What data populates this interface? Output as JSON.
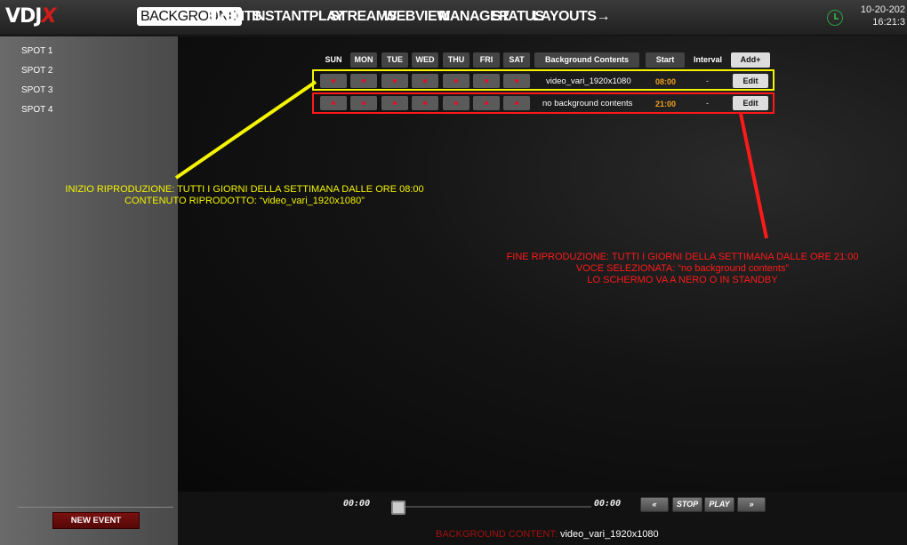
{
  "app": {
    "logo_text": "VDJ",
    "logo_accent": "X"
  },
  "nav": {
    "items": [
      "BACKGROUND",
      "EVENTS",
      "INSTANTPLAY",
      "STREAMS",
      "WEBVIEW",
      "MANAGER",
      "STATUS",
      "LAYOUTS→"
    ],
    "active": "BACKGROUND"
  },
  "datetime": {
    "date": "10-20-202",
    "time": "16:21:3"
  },
  "sidebar": {
    "spots": [
      "SPOT 1",
      "SPOT 2",
      "SPOT 3",
      "SPOT 4"
    ],
    "new_event_label": "NEW EVENT"
  },
  "table": {
    "headers": {
      "days": [
        "SUN",
        "MON",
        "TUE",
        "WED",
        "THU",
        "FRI",
        "SAT"
      ],
      "contents": "Background Contents",
      "start": "Start",
      "interval": "Interval",
      "add": "Add+"
    },
    "rows": [
      {
        "contents": "video_vari_1920x1080",
        "start": "08:00",
        "interval": "-",
        "edit": "Edit",
        "highlight": "#f4f400"
      },
      {
        "contents": "no background contents",
        "start": "21:00",
        "interval": "-",
        "edit": "Edit",
        "highlight": "#ff1a1a"
      }
    ]
  },
  "annotations": {
    "yellow": [
      "INIZIO RIPRODUZIONE: TUTTI I GIORNI DELLA SETTIMANA DALLE ORE 08:00",
      "CONTENUTO RIPRODOTTO: “video_vari_1920x1080”"
    ],
    "red": [
      "FINE RIPRODUZIONE: TUTTI I GIORNI DELLA SETTIMANA DALLE ORE 21:00",
      "VOCE SELEZIONATA: “no background contents”",
      "LO SCHERMO VA A NERO O IN STANDBY"
    ]
  },
  "transport": {
    "time_left": "00:00",
    "time_right": "00:00",
    "rewind": "«",
    "stop": "STOP",
    "play": "PLAY",
    "forward": "»"
  },
  "status": {
    "label": "BACKGROUND CONTENT:",
    "value": "video_vari_1920x1080"
  },
  "colors": {
    "accent_red": "#d31b1b",
    "yellow_annot": "#f4f400",
    "red_annot": "#ff1a1a",
    "time_orange": "#f0a020"
  }
}
